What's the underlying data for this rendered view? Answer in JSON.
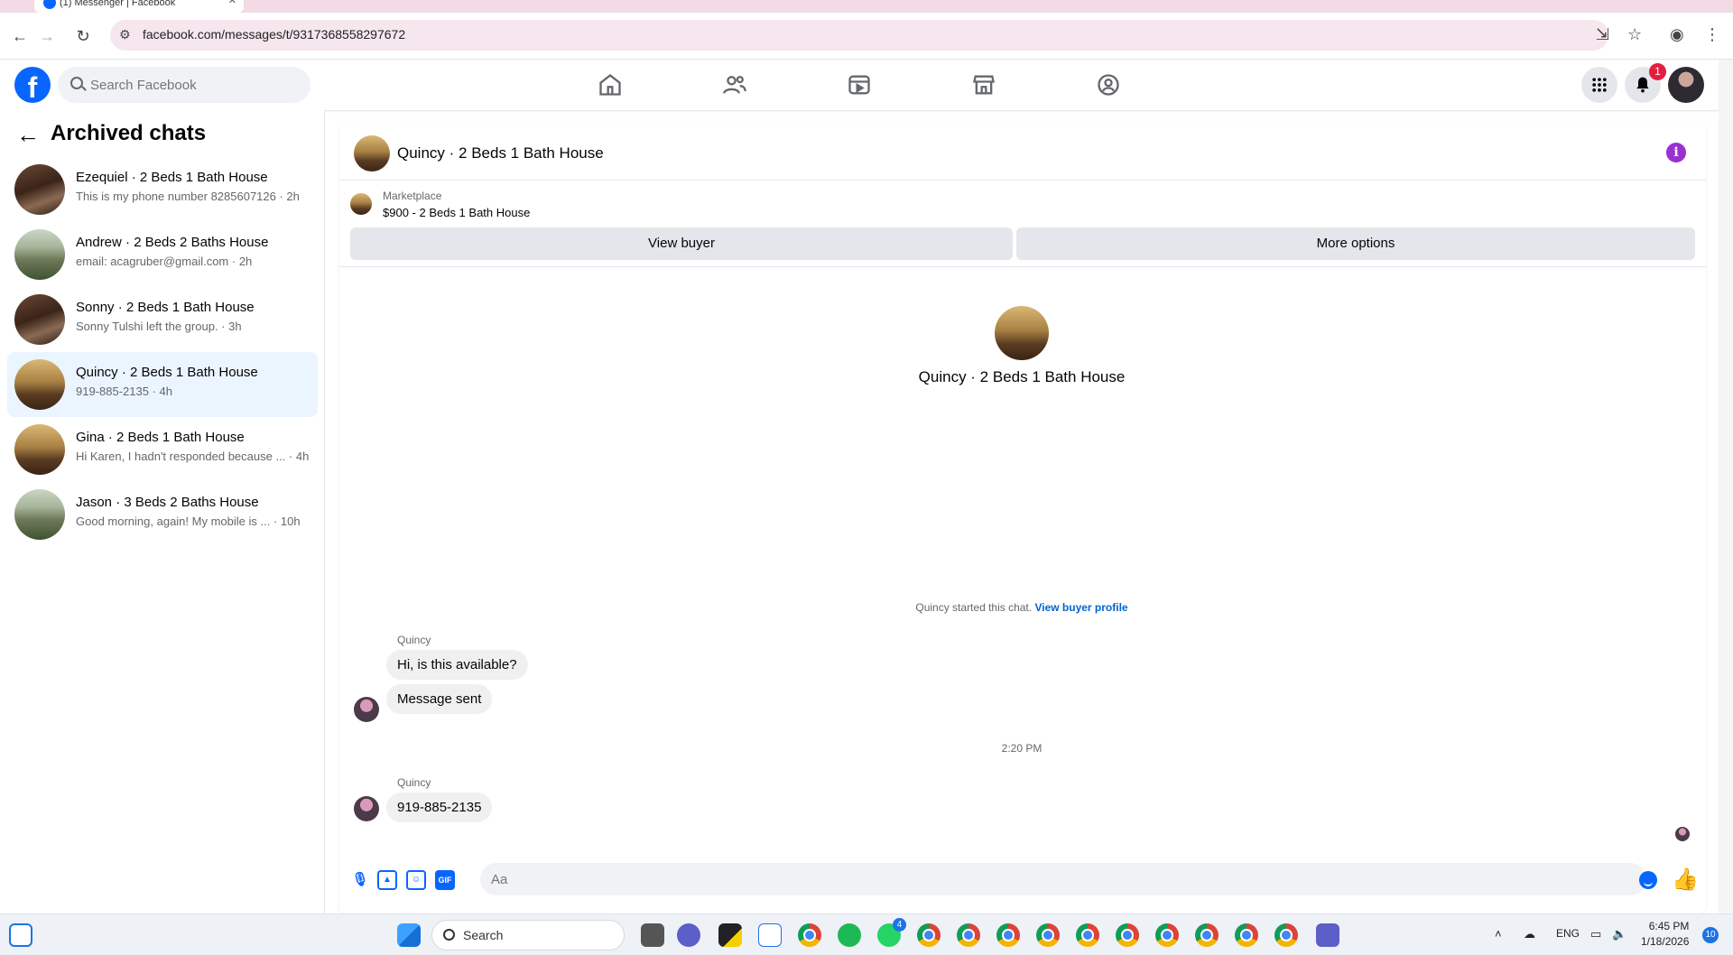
{
  "browser": {
    "tab_title": "(1) Messenger | Facebook",
    "url": "facebook.com/messages/t/9317368558297672"
  },
  "fb": {
    "logo": "f",
    "search_placeholder": "Search Facebook",
    "notification_count": "1"
  },
  "sidebar": {
    "title": "Archived chats",
    "chats": [
      {
        "name": "Ezequiel · 2 Beds 1 Bath House",
        "preview": "This is my phone number 8285607126 · 2h"
      },
      {
        "name": "Andrew · 2 Beds 2 Baths House",
        "preview": "email: acagruber@gmail.com · 2h"
      },
      {
        "name": "Sonny · 2 Beds 1 Bath House",
        "preview": "Sonny Tulshi left the group. · 3h"
      },
      {
        "name": "Quincy · 2 Beds 1 Bath House",
        "preview": "919-885-2135 · 4h"
      },
      {
        "name": "Gina · 2 Beds 1 Bath House",
        "preview": "Hi Karen, I hadn't responded because ...  · 4h"
      },
      {
        "name": "Jason · 3 Beds 2 Baths House",
        "preview": "Good morning, again! My mobile is ...  · 10h"
      }
    ]
  },
  "conversation": {
    "title": "Quincy · 2 Beds 1 Bath House",
    "marketplace_label": "Marketplace",
    "listing": "$900 - 2 Beds 1 Bath House",
    "view_buyer": "View buyer",
    "more_options": "More options",
    "intro_name": "Quincy · 2 Beds 1 Bath House",
    "started_text": "Quincy started this chat.",
    "started_link": "View buyer profile",
    "messages": [
      {
        "sender": "Quincy",
        "text": "Hi, is this available?"
      },
      {
        "text": "Message sent"
      },
      {
        "time": "2:20 PM"
      },
      {
        "sender": "Quincy",
        "text": "919-885-2135"
      }
    ],
    "composer_placeholder": "Aa",
    "gif_label": "GIF"
  },
  "taskbar": {
    "search_label": "Search",
    "language": "ENG",
    "time": "6:45 PM",
    "date": "1/18/2026",
    "whatsapp_badge": "4",
    "notif_count": "10"
  }
}
